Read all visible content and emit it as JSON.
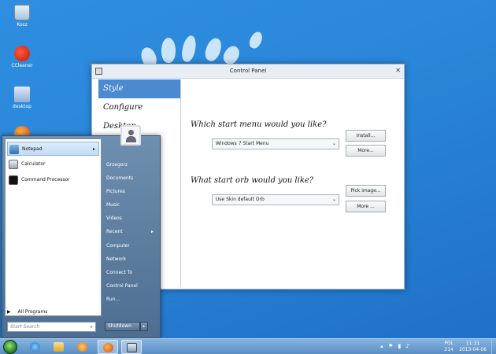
{
  "desktop": {
    "icons": [
      {
        "label": "Kosz",
        "icon": "recycle-bin-icon"
      },
      {
        "label": "CCleaner",
        "icon": "ccleaner-icon"
      },
      {
        "label": "desktop",
        "icon": "desktop-file-icon"
      }
    ]
  },
  "control_panel": {
    "title": "Control Panel",
    "nav": [
      {
        "label": "Style",
        "active": true
      },
      {
        "label": "Configure",
        "active": false
      },
      {
        "label": "Desktop",
        "active": false
      }
    ],
    "start_menu_question": "Which start menu would you like?",
    "start_menu_value": "Windows 7 Start Menu",
    "install_label": "Install...",
    "more1_label": "More...",
    "orb_question": "What start orb would you like?",
    "orb_value": "Use Skin default Orb",
    "pick_label": "Pick image...",
    "more2_label": "More ..."
  },
  "start_menu": {
    "left_items": [
      {
        "label": "Notepad",
        "icon": "notepad-icon",
        "submenu": true
      },
      {
        "label": "Calculator",
        "icon": "calculator-icon",
        "submenu": false
      },
      {
        "label": "Command Processor",
        "icon": "cmd-icon",
        "submenu": false
      }
    ],
    "all_programs": "All Programs",
    "search_placeholder": "Start Search",
    "right_items": [
      {
        "label": "Grzegorz",
        "submenu": false
      },
      {
        "label": "Documents",
        "submenu": false
      },
      {
        "label": "Pictures",
        "submenu": false
      },
      {
        "label": "Music",
        "submenu": false
      },
      {
        "label": "Videos",
        "submenu": false
      },
      {
        "label": "Recent",
        "submenu": true
      },
      {
        "label": "Computer",
        "submenu": false
      },
      {
        "label": "Network",
        "submenu": false
      },
      {
        "label": "Connect To",
        "submenu": false
      },
      {
        "label": "Control Panel",
        "submenu": false
      },
      {
        "label": "Run...",
        "submenu": false
      }
    ],
    "shutdown_label": "Shutdown"
  },
  "taskbar": {
    "apps": [
      "internet-explorer-icon",
      "file-explorer-icon",
      "media-player-icon",
      "firefox-icon",
      "control-panel-icon"
    ],
    "language": "POL",
    "language_sub": "214",
    "time": "11:31",
    "date": "2013-04-06"
  },
  "colors": {
    "accent": "#4b8ad1",
    "desktop": "#2a86d8",
    "taskbar": "#6f9fd2"
  }
}
